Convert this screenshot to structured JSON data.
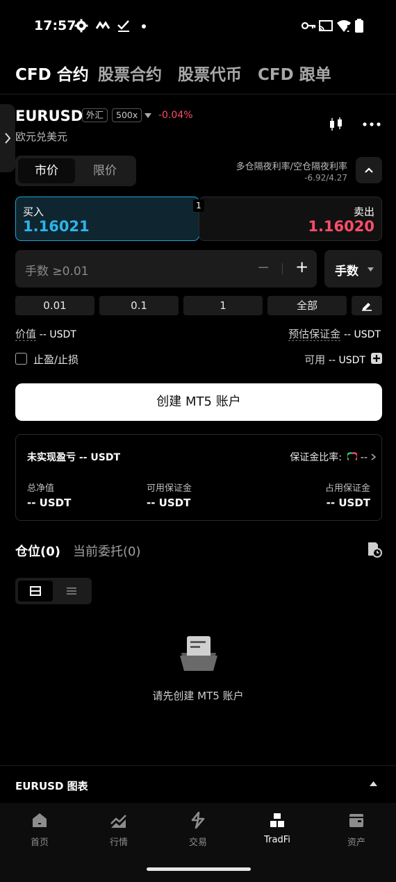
{
  "status_bar": {
    "time": "17:57"
  },
  "top_tabs": [
    "CFD 合约",
    "股票合约",
    "股票代币",
    "CFD 跟单"
  ],
  "instrument": {
    "symbol": "EURUSD",
    "tag1": "外汇",
    "tag2": "500x",
    "change": "-0.04%",
    "subtitle": "欧元兑美元"
  },
  "order_type": {
    "market": "市价",
    "limit": "限价"
  },
  "swap": {
    "label": "多仓隔夜利率/空仓隔夜利率",
    "value": "-6.92/4.27"
  },
  "buy": {
    "label": "买入",
    "price": "1.16021"
  },
  "sell": {
    "label": "卖出",
    "price": "1.16020"
  },
  "spread": "1",
  "lot": {
    "placeholder": "手数 ≥0.01",
    "minus": "−",
    "plus": "+",
    "unit": "手数"
  },
  "quick_amounts": [
    "0.01",
    "0.1",
    "1",
    "全部"
  ],
  "value": {
    "label": "价值",
    "amount": "-- USDT"
  },
  "margin_est": {
    "label": "预估保证金",
    "amount": "-- USDT"
  },
  "tp_sl": {
    "label": "止盈/止损"
  },
  "available": {
    "label": "可用",
    "amount": "-- USDT"
  },
  "create_button": "创建 MT5 账户",
  "summary": {
    "unrealized_label": "未实现盈亏",
    "unrealized_value": "-- USDT",
    "margin_ratio_label": "保证金比率:",
    "margin_ratio_value": "--",
    "equity_label": "总净值",
    "equity_value": "-- USDT",
    "free_margin_label": "可用保证金",
    "free_margin_value": "-- USDT",
    "used_margin_label": "占用保证金",
    "used_margin_value": "-- USDT"
  },
  "positions": {
    "tab_positions": "仓位(0)",
    "tab_orders": "当前委托(0)"
  },
  "empty_state": "请先创建 MT5 账户",
  "chart_bar": {
    "label": "EURUSD 图表"
  },
  "bottom_nav": [
    "首页",
    "行情",
    "交易",
    "TradFi",
    "资产"
  ],
  "colors": {
    "buy_accent": "#1fa3d9",
    "sell_accent": "#ff4d6a",
    "negative": "#ff4d6a"
  }
}
